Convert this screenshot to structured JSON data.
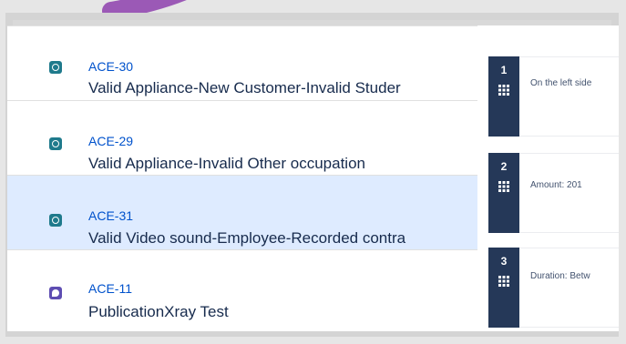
{
  "colors": {
    "accent_link": "#0052cc",
    "selected_row": "#deebff",
    "step_badge": "#253858",
    "annotation_arrow": "#9b59b6"
  },
  "issues": [
    {
      "key": "ACE-30",
      "summary": "Valid Appliance-New Customer-Invalid Studer",
      "icon": "test-issue-icon",
      "selected": false
    },
    {
      "key": "ACE-29",
      "summary": "Valid Appliance-Invalid Other occupation",
      "icon": "test-issue-icon",
      "selected": false
    },
    {
      "key": "ACE-31",
      "summary": "Valid Video sound-Employee-Recorded contra",
      "icon": "test-issue-icon",
      "selected": true
    },
    {
      "key": "ACE-11",
      "summary": "PublicationXray Test",
      "icon": "story-issue-icon",
      "selected": false
    }
  ],
  "steps": [
    {
      "number": "1",
      "text": "On the left side"
    },
    {
      "number": "2",
      "text": "Amount: 201"
    },
    {
      "number": "3",
      "text": "Duration: Betw"
    }
  ]
}
